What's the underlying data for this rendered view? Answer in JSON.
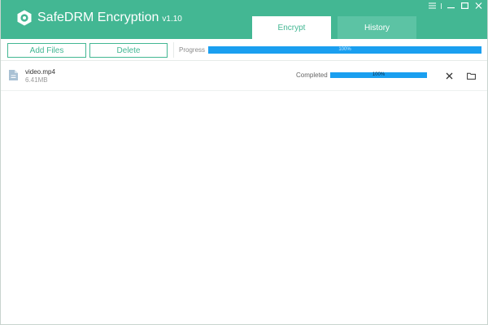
{
  "app": {
    "title": "SafeDRM Encryption",
    "version": "v1.10",
    "brand_color": "#43b793",
    "icons": [
      "app-logo-icon",
      "menu-icon",
      "minimize-icon",
      "maximize-icon",
      "close-icon"
    ]
  },
  "tabs": [
    {
      "label": "Encrypt",
      "active": true
    },
    {
      "label": "History",
      "active": false
    }
  ],
  "toolbar": {
    "add_files_label": "Add Files",
    "delete_label": "Delete",
    "progress_label": "Progress",
    "overall_progress_text": "100%",
    "overall_progress_value": 1.0,
    "progress_color": "#1a9ff0"
  },
  "files": [
    {
      "name": "video.mp4",
      "size": "6.41MB",
      "status": "Completed",
      "progress_text": "100%",
      "progress_value": 1.0,
      "icons": [
        "file-icon",
        "remove-icon",
        "open-folder-icon"
      ]
    }
  ]
}
